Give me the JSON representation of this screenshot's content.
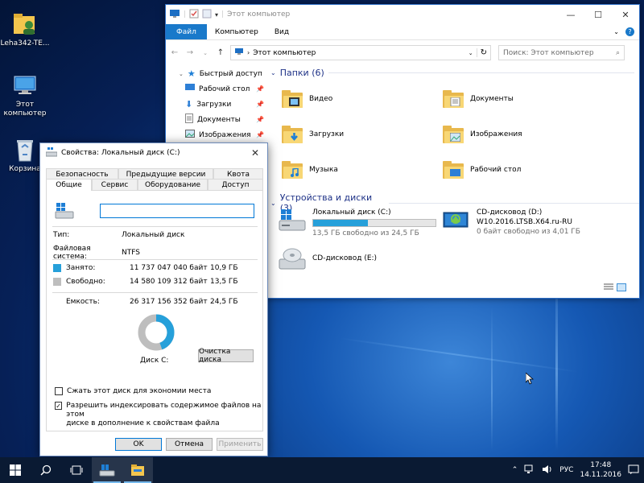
{
  "desktop": {
    "icons": [
      {
        "label": "Leha342-TE...",
        "icon": "user-folder-icon"
      },
      {
        "label": "Этот компьютер",
        "icon": "computer-icon"
      },
      {
        "label": "Корзина",
        "icon": "recycle-bin-icon"
      }
    ]
  },
  "explorer": {
    "title": "Этот компьютер",
    "ribbon_tabs": [
      "Файл",
      "Компьютер",
      "Вид"
    ],
    "address": "Этот компьютер",
    "search_placeholder": "Поиск: Этот компьютер",
    "nav_items": [
      {
        "label": "Быстрый доступ",
        "icon": "star-icon",
        "pinned": false
      },
      {
        "label": "Рабочий стол",
        "icon": "desktop-icon",
        "pinned": true
      },
      {
        "label": "Загрузки",
        "icon": "download-icon",
        "pinned": true
      },
      {
        "label": "Документы",
        "icon": "documents-icon",
        "pinned": true
      },
      {
        "label": "Изображения",
        "icon": "pictures-icon",
        "pinned": true
      }
    ],
    "folders_header": "Папки (6)",
    "folders": [
      {
        "label": "Видео",
        "icon": "video-folder-icon"
      },
      {
        "label": "Документы",
        "icon": "documents-folder-icon"
      },
      {
        "label": "Загрузки",
        "icon": "downloads-folder-icon"
      },
      {
        "label": "Изображения",
        "icon": "pictures-folder-icon"
      },
      {
        "label": "Музыка",
        "icon": "music-folder-icon"
      },
      {
        "label": "Рабочий стол",
        "icon": "desktop-folder-icon"
      }
    ],
    "devices_header": "Устройства и диски (3)",
    "devices": [
      {
        "label": "Локальный диск (C:)",
        "sub": "13,5 ГБ свободно из 24,5 ГБ",
        "used_fraction": 0.45,
        "icon": "windows-drive-icon"
      },
      {
        "label": "CD-дисковод (D:)",
        "line2": "W10.2016.LTSB.X64.ru-RU",
        "sub": "0 байт свободно из 4,01 ГБ",
        "icon": "dvd-install-icon"
      },
      {
        "label": "CD-дисковод (E:)",
        "icon": "cd-drive-icon"
      }
    ]
  },
  "props": {
    "title": "Свойства: Локальный диск (C:)",
    "tabs_row1": [
      "Безопасность",
      "Предыдущие версии",
      "Квота"
    ],
    "tabs_row2": [
      "Общие",
      "Сервис",
      "Оборудование",
      "Доступ"
    ],
    "name_value": "",
    "type_label": "Тип:",
    "type_value": "Локальный диск",
    "fs_label": "Файловая система:",
    "fs_value": "NTFS",
    "used_label": "Занято:",
    "used_bytes": "11 737 047 040 байт",
    "used_gb": "10,9 ГБ",
    "free_label": "Свободно:",
    "free_bytes": "14 580 109 312 байт",
    "free_gb": "13,5 ГБ",
    "capacity_label": "Емкость:",
    "capacity_bytes": "26 317 156 352 байт",
    "capacity_gb": "24,5 ГБ",
    "used_fraction": 0.446,
    "disk_label": "Диск C:",
    "cleanup_button": "Очистка диска",
    "compress_label": "Сжать этот диск для экономии места",
    "compress_checked": false,
    "index_label_1": "Разрешить индексировать содержимое файлов на этом",
    "index_label_2": "диске в дополнение к свойствам файла",
    "index_checked": true,
    "ok": "OK",
    "cancel": "Отмена",
    "apply": "Применить",
    "used_color": "#26a0da",
    "free_color": "#bebebe"
  },
  "taskbar": {
    "lang": "РУС",
    "time": "17:48",
    "date": "14.11.2016"
  }
}
